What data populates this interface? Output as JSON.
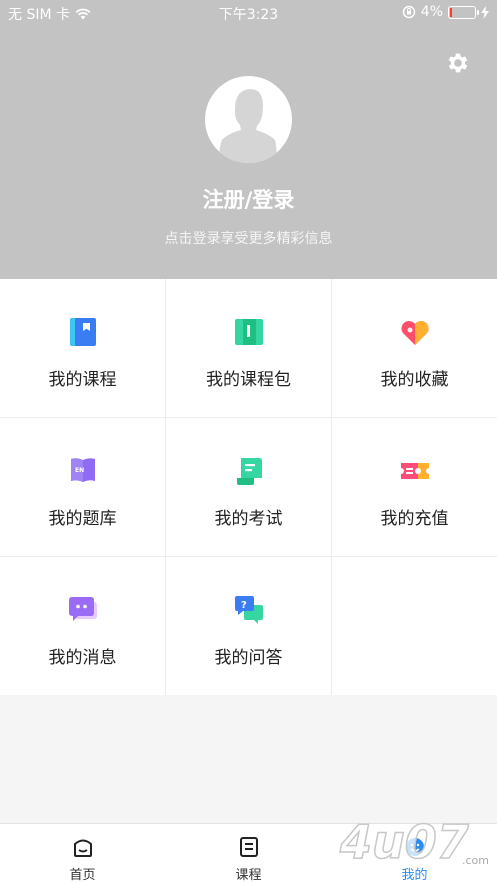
{
  "status_bar": {
    "carrier": "无 SIM 卡",
    "time": "下午3:23",
    "battery": "4%"
  },
  "profile": {
    "login_title": "注册/登录",
    "login_subtitle": "点击登录享受更多精彩信息"
  },
  "menu": {
    "items": [
      {
        "label": "我的课程",
        "icon": "course-book-icon"
      },
      {
        "label": "我的课程包",
        "icon": "course-package-icon"
      },
      {
        "label": "我的收藏",
        "icon": "favorite-heart-icon"
      },
      {
        "label": "我的题库",
        "icon": "question-bank-icon"
      },
      {
        "label": "我的考试",
        "icon": "exam-scroll-icon"
      },
      {
        "label": "我的充值",
        "icon": "recharge-ticket-icon"
      },
      {
        "label": "我的消息",
        "icon": "message-chat-icon"
      },
      {
        "label": "我的问答",
        "icon": "qa-bubble-icon"
      }
    ]
  },
  "tabbar": {
    "tabs": [
      {
        "label": "首页",
        "icon": "home-icon"
      },
      {
        "label": "课程",
        "icon": "course-list-icon"
      },
      {
        "label": "我的",
        "icon": "profile-smile-icon",
        "active": true
      }
    ]
  },
  "watermark": {
    "text": "4u07"
  },
  "colors": {
    "accent": "#2a8bf2",
    "header_bg": "#c3c3c3"
  }
}
